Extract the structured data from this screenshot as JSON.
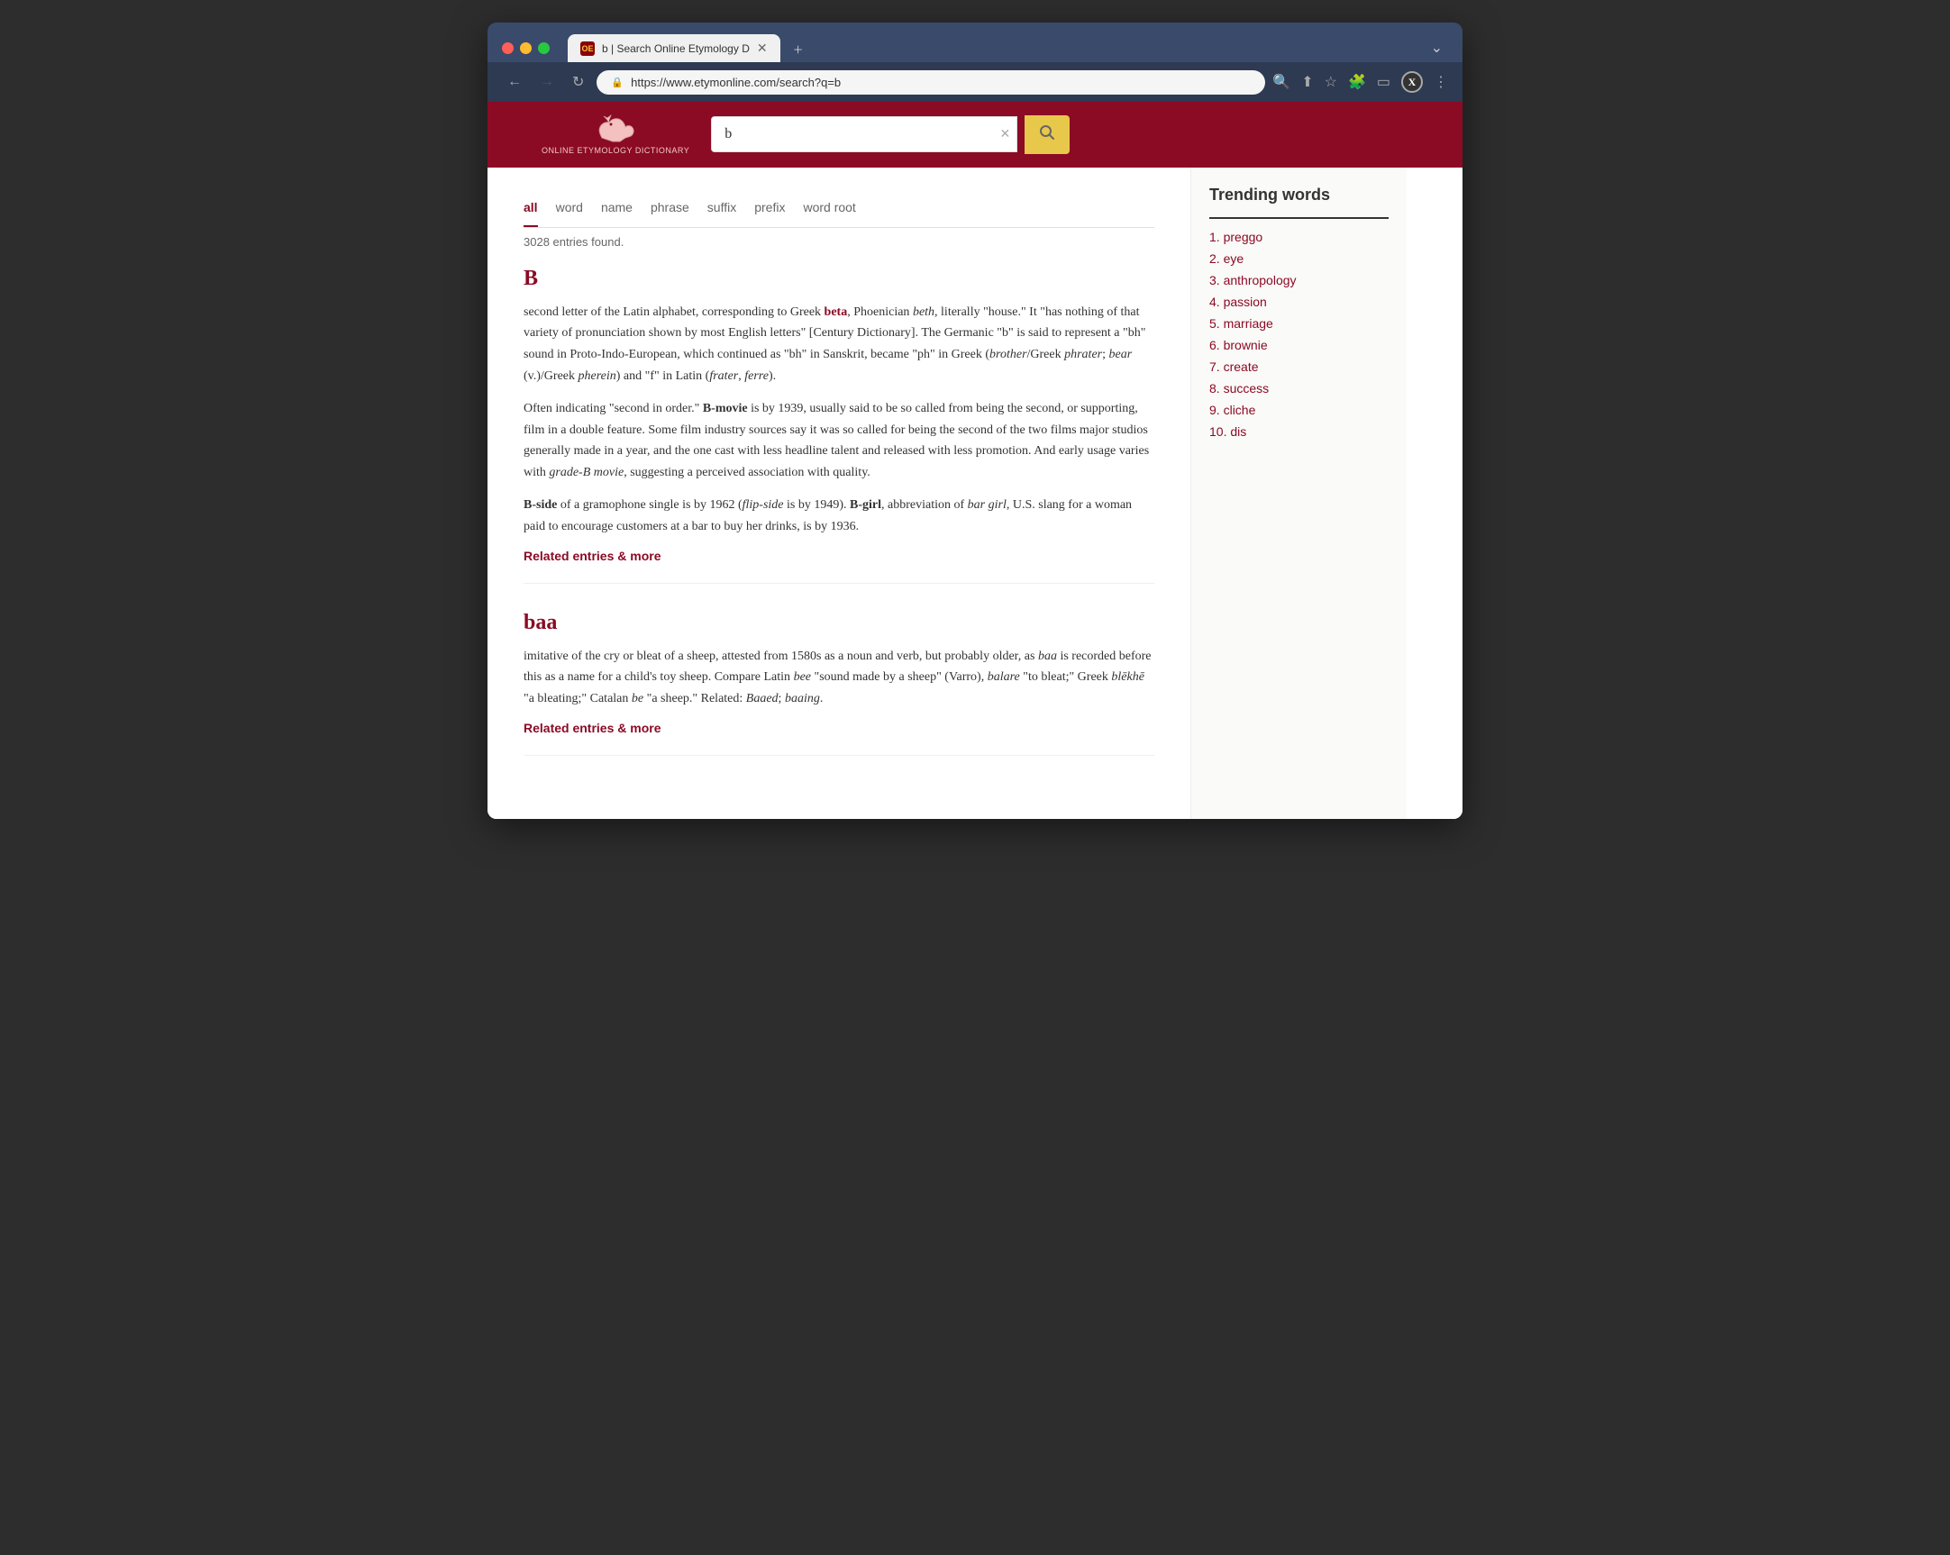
{
  "browser": {
    "tab_title": "b | Search Online Etymology D",
    "tab_favicon": "OE",
    "url": "https://www.etymonline.com/search?q=b",
    "new_tab_label": "+",
    "back_btn": "←",
    "forward_btn": "→",
    "refresh_btn": "↻",
    "profile_btn": "X"
  },
  "site": {
    "logo_text": "ONLINE ETYMOLOGY DICTIONARY",
    "search_value": "b",
    "search_placeholder": "b",
    "search_btn_icon": "🔍"
  },
  "filter_tabs": [
    {
      "id": "all",
      "label": "all",
      "active": true
    },
    {
      "id": "word",
      "label": "word",
      "active": false
    },
    {
      "id": "name",
      "label": "name",
      "active": false
    },
    {
      "id": "phrase",
      "label": "phrase",
      "active": false
    },
    {
      "id": "suffix",
      "label": "suffix",
      "active": false
    },
    {
      "id": "prefix",
      "label": "prefix",
      "active": false
    },
    {
      "id": "word_root",
      "label": "word root",
      "active": false
    }
  ],
  "results_count": "3028 entries found.",
  "entries": [
    {
      "id": "B",
      "word": "B",
      "body_html": "second letter of the Latin alphabet, corresponding to Greek <strong-link>beta</strong-link>, Phoenician <em>beth</em>, literally \"house.\" It \"has nothing of that variety of pronunciation shown by most English letters\" [Century Dictionary]. The Germanic \"b\" is said to represent a \"bh\" sound in Proto-Indo-European, which continued as \"bh\" in Sanskrit, became \"ph\" in Greek (<em>brother</em>/Greek <em>phrater</em>; <em>bear</em> (v.)/Greek <em>pherein</em>) and \"f\" in Latin (<em>frater</em>, <em>ferre</em>).",
      "body2_html": "Often indicating \"second in order.\" <strong>B-movie</strong> is by 1939, usually said to be so called from being the second, or supporting, film in a double feature. Some film industry sources say it was so called for being the second of the two films major studios generally made in a year, and the one cast with less headline talent and released with less promotion. And early usage varies with <em>grade-B movie</em>, suggesting a perceived association with quality.",
      "body3_html": "<strong>B-side</strong> of a gramophone single is by 1962 (<em>flip-side</em> is by 1949). <strong>B-girl</strong>, abbreviation of <em>bar girl</em>, U.S. slang for a woman paid to encourage customers at a bar to buy her drinks, is by 1936.",
      "related_link": "Related entries & more"
    },
    {
      "id": "baa",
      "word": "baa",
      "body_html": "imitative of the cry or bleat of a sheep, attested from 1580s as a noun and verb, but probably older, as <em>baa</em> is recorded before this as a name for a child's toy sheep. Compare Latin <em>bee</em> \"sound made by a sheep\" (Varro), <em>balare</em> \"to bleat;\" Greek <em>blēkhē</em> \"a bleating;\" Catalan <em>be</em> \"a sheep.\" Related: <em>Baaed</em>; <em>baaing</em>.",
      "related_link": "Related entries & more"
    }
  ],
  "trending": {
    "title": "Trending words",
    "items": [
      {
        "rank": "1.",
        "word": "preggo"
      },
      {
        "rank": "2.",
        "word": "eye"
      },
      {
        "rank": "3.",
        "word": "anthropology"
      },
      {
        "rank": "4.",
        "word": "passion"
      },
      {
        "rank": "5.",
        "word": "marriage"
      },
      {
        "rank": "6.",
        "word": "brownie"
      },
      {
        "rank": "7.",
        "word": "create"
      },
      {
        "rank": "8.",
        "word": "success"
      },
      {
        "rank": "9.",
        "word": "cliche"
      },
      {
        "rank": "10.",
        "word": "dis"
      }
    ]
  }
}
